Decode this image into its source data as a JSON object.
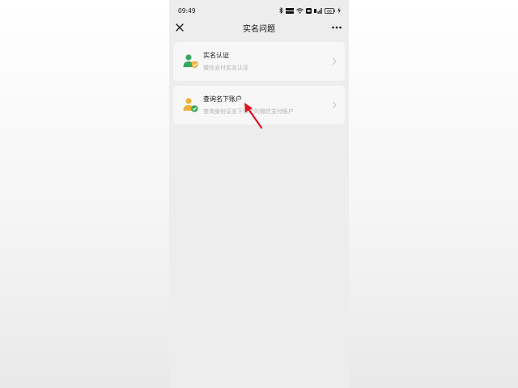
{
  "status_bar": {
    "time": "09:49",
    "battery": "88"
  },
  "header": {
    "title": "实名问题",
    "close_icon": "close-icon",
    "more_icon": "more-icon"
  },
  "items": [
    {
      "title": "实名认证",
      "subtitle": "微信支付实名认证",
      "icon": "user-shield-icon",
      "icon_color": "#3aa55e",
      "badge_color": "#f0b03c"
    },
    {
      "title": "查询名下账户",
      "subtitle": "查询身份证名下绑定的微信支付账户",
      "icon": "user-check-icon",
      "icon_color": "#f0b03c",
      "badge_color": "#3aa55e"
    }
  ],
  "annotation": {
    "color": "#e0141e"
  }
}
